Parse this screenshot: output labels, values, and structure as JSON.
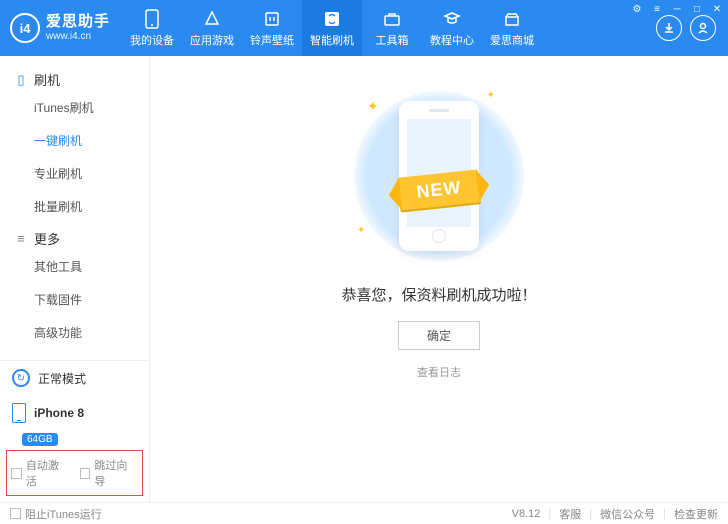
{
  "brand": {
    "logo_text": "i4",
    "title": "爱思助手",
    "subtitle": "www.i4.cn"
  },
  "nav": {
    "items": [
      {
        "label": "我的设备",
        "icon": "device"
      },
      {
        "label": "应用游戏",
        "icon": "apps"
      },
      {
        "label": "铃声壁纸",
        "icon": "media"
      },
      {
        "label": "智能刷机",
        "icon": "flash",
        "active": true
      },
      {
        "label": "工具箱",
        "icon": "toolbox"
      },
      {
        "label": "教程中心",
        "icon": "tutorial"
      },
      {
        "label": "爱思商城",
        "icon": "store"
      }
    ]
  },
  "sidebar": {
    "group1": {
      "title": "刷机",
      "items": [
        "iTunes刷机",
        "一键刷机",
        "专业刷机",
        "批量刷机"
      ],
      "active_index": 1
    },
    "group2": {
      "title": "更多",
      "items": [
        "其他工具",
        "下载固件",
        "高级功能"
      ]
    },
    "mode": "正常模式",
    "device_name": "iPhone 8",
    "device_storage": "64GB",
    "checkbox1": "自动激活",
    "checkbox2": "跳过向导"
  },
  "main": {
    "ribbon": "NEW",
    "success_text": "恭喜您，保资料刷机成功啦！",
    "ok_button": "确定",
    "view_log": "查看日志"
  },
  "footer": {
    "block_itunes": "阻止iTunes运行",
    "version": "V8.12",
    "links": [
      "客服",
      "微信公众号",
      "检查更新"
    ]
  }
}
